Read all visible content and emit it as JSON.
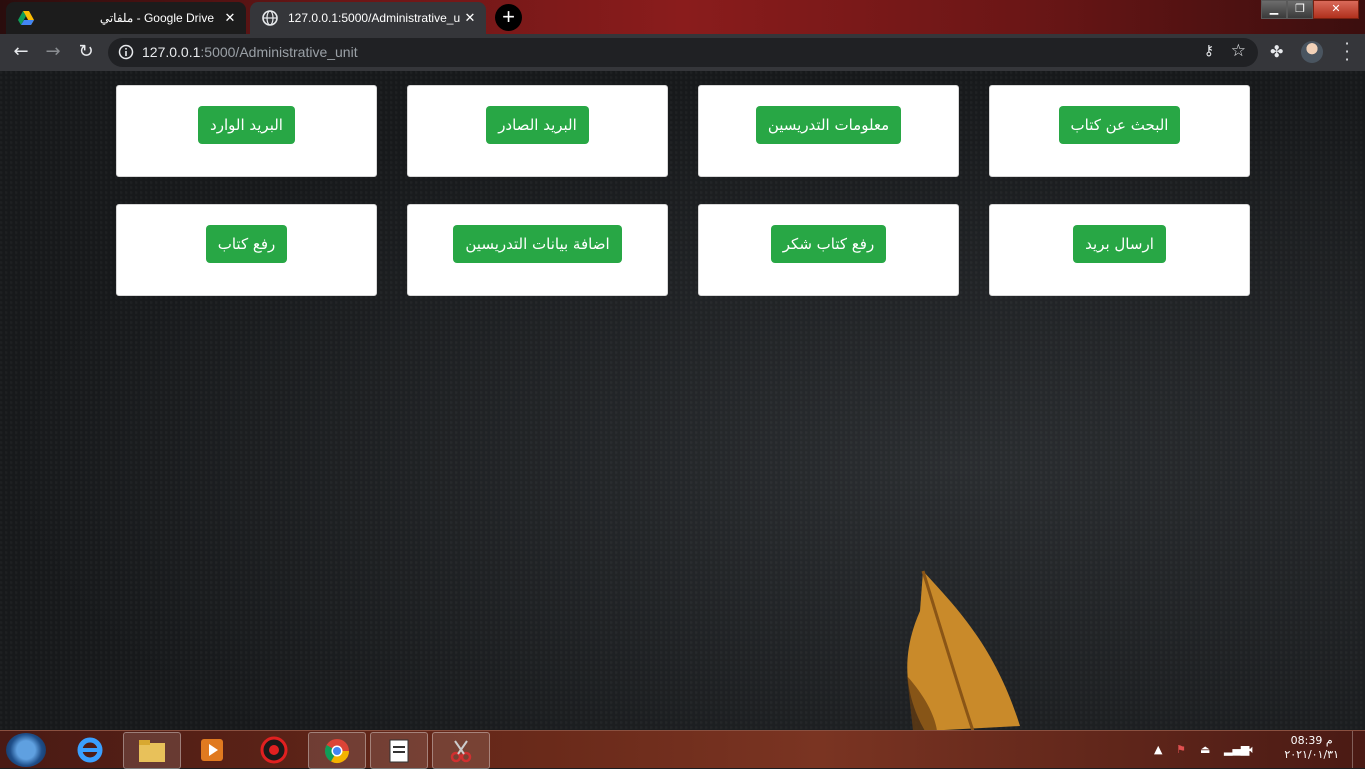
{
  "browser": {
    "tabs": [
      {
        "title": "ملفاتي - Google Drive",
        "icon": "google-drive-icon",
        "active": false
      },
      {
        "title": "127.0.0.1:5000/Administrative_unit",
        "icon": "globe-icon",
        "active": true
      }
    ],
    "new_tab_label": "+",
    "address": {
      "host": "127.0.0.1",
      "path": ":5000/Administrative_unit"
    }
  },
  "page": {
    "accent_color": "#28a745",
    "rows": [
      [
        "البحث عن كتاب",
        "معلومات التدريسين",
        "البريد الصادر",
        "البريد الوارد"
      ],
      [
        "ارسال بريد",
        "رفع كتاب شكر",
        "اضافة بيانات التدريسين",
        "رفع كتاب"
      ]
    ]
  },
  "taskbar": {
    "pinned": [
      "internet-explorer-icon",
      "file-explorer-icon",
      "media-player-icon",
      "app-red-icon",
      "chrome-icon",
      "notepad-icon",
      "snipping-tool-icon"
    ],
    "clock": {
      "time": "08:39 م",
      "date": "٢٠٢١/٠١/٣١"
    }
  }
}
